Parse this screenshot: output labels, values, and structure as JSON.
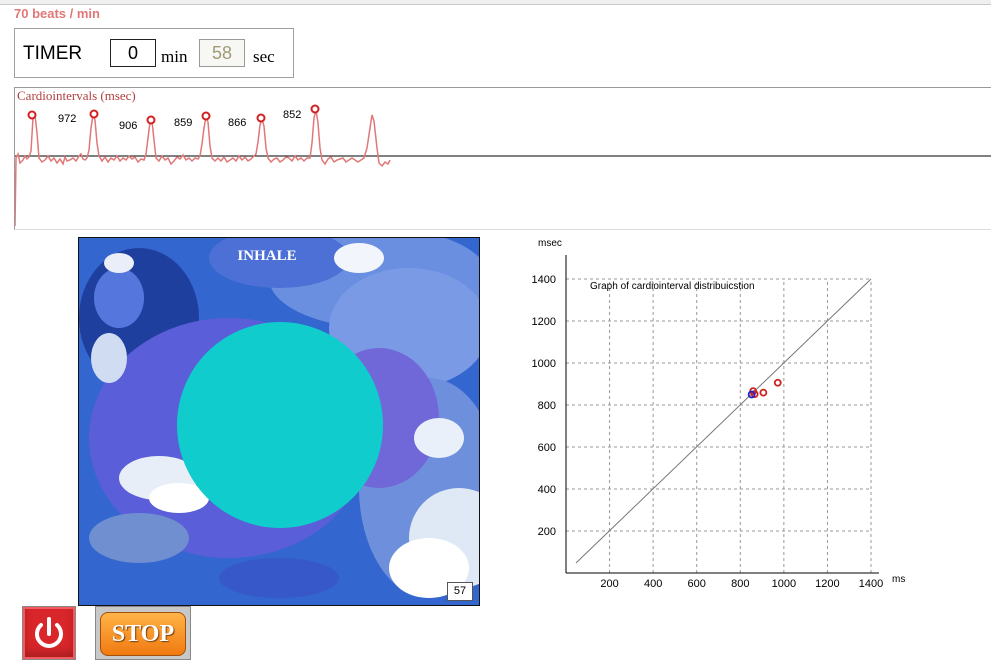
{
  "header": {
    "heart_rate": "70  beats / min"
  },
  "timer": {
    "label": "TIMER",
    "minutes": "0",
    "min_unit": "min",
    "seconds": "58",
    "sec_unit": "sec"
  },
  "cardio": {
    "title": "Cardiointervals  (msec)",
    "intervals": [
      "972",
      "906",
      "859",
      "866",
      "852"
    ]
  },
  "breath": {
    "phase": "INHALE",
    "counter": "57"
  },
  "buttons": {
    "stop_label": "STOP",
    "power_icon": "power-icon"
  },
  "colors": {
    "heart_rate_text": "#e07878",
    "ecg_trace": "#e07878",
    "peak_marker": "#d22020",
    "breath_circle": "#11cccc",
    "scatter_red": "#cc2222",
    "scatter_blue": "#2222cc"
  },
  "chart_data": {
    "type": "scatter",
    "title": "Graph of cardiointerval distribuicstion",
    "xlabel": "ms",
    "ylabel": "msec",
    "xlim": [
      0,
      1400
    ],
    "ylim": [
      0,
      1400
    ],
    "x_ticks": [
      200,
      400,
      600,
      800,
      1000,
      1200,
      1400
    ],
    "y_ticks": [
      200,
      400,
      600,
      800,
      1000,
      1200,
      1400
    ],
    "grid": true,
    "diagonal": true,
    "series": [
      {
        "color": "#cc2222",
        "points": [
          [
            972,
            906
          ],
          [
            906,
            859
          ],
          [
            859,
            866
          ],
          [
            866,
            852
          ]
        ]
      },
      {
        "color": "#2222cc",
        "points": [
          [
            852,
            850
          ]
        ]
      }
    ]
  }
}
